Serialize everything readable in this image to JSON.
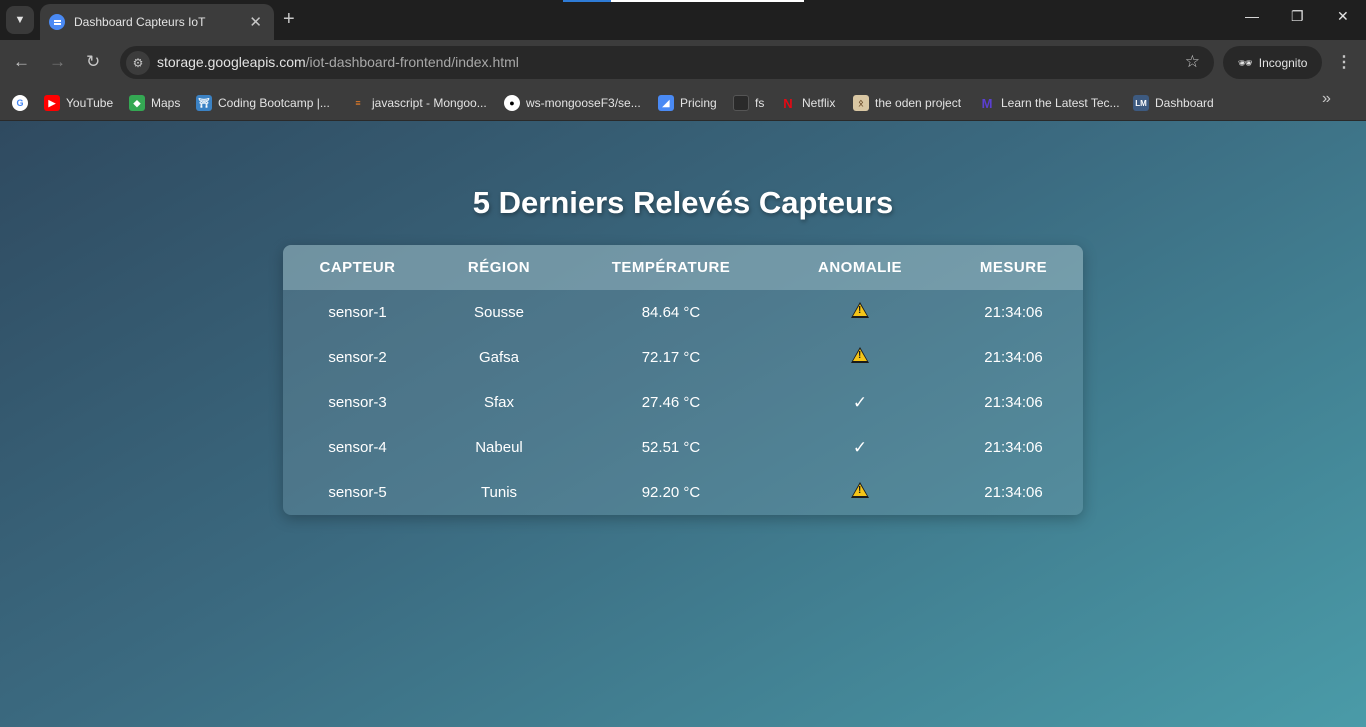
{
  "browser": {
    "tab_title": "Dashboard Capteurs IoT",
    "url_host": "storage.googleapis.com",
    "url_path": "/iot-dashboard-frontend/index.html",
    "incognito_label": "Incognito",
    "bookmarks": [
      {
        "label": "YouTube",
        "icon": "youtube-icon",
        "color": "#ff0000"
      },
      {
        "label": "Maps",
        "icon": "maps-icon",
        "color": "#34a853"
      },
      {
        "label": "Coding Bootcamp |...",
        "icon": "torii-icon",
        "color": "#3b82c4"
      },
      {
        "label": "javascript - Mongoo...",
        "icon": "stackoverflow-icon",
        "color": "#f48024"
      },
      {
        "label": "ws-mongooseF3/se...",
        "icon": "github-icon",
        "color": "#ffffff"
      },
      {
        "label": "Pricing",
        "icon": "pricing-icon",
        "color": "#4a8af4"
      },
      {
        "label": "fs",
        "icon": "fs-icon",
        "color": "#555555"
      },
      {
        "label": "Netflix",
        "icon": "netflix-icon",
        "color": "#e50914"
      },
      {
        "label": "the oden project",
        "icon": "odin-icon",
        "color": "#d9c7a3"
      },
      {
        "label": "Learn the Latest Tec...",
        "icon": "learn-icon",
        "color": "#5b3fd1"
      },
      {
        "label": "Dashboard",
        "icon": "dashboard-icon",
        "color": "#3d5a80"
      }
    ]
  },
  "page": {
    "title": "5 Derniers Relevés Capteurs",
    "columns": [
      "CAPTEUR",
      "RÉGION",
      "TEMPÉRATURE",
      "ANOMALIE",
      "MESURE"
    ],
    "rows": [
      {
        "sensor": "sensor-1",
        "region": "Sousse",
        "temperature": "84.64 °C",
        "anomaly": true,
        "time": "21:34:06"
      },
      {
        "sensor": "sensor-2",
        "region": "Gafsa",
        "temperature": "72.17 °C",
        "anomaly": true,
        "time": "21:34:06"
      },
      {
        "sensor": "sensor-3",
        "region": "Sfax",
        "temperature": "27.46 °C",
        "anomaly": false,
        "time": "21:34:06"
      },
      {
        "sensor": "sensor-4",
        "region": "Nabeul",
        "temperature": "52.51 °C",
        "anomaly": false,
        "time": "21:34:06"
      },
      {
        "sensor": "sensor-5",
        "region": "Tunis",
        "temperature": "92.20 °C",
        "anomaly": true,
        "time": "21:34:06"
      }
    ],
    "ok_symbol": "✓"
  }
}
